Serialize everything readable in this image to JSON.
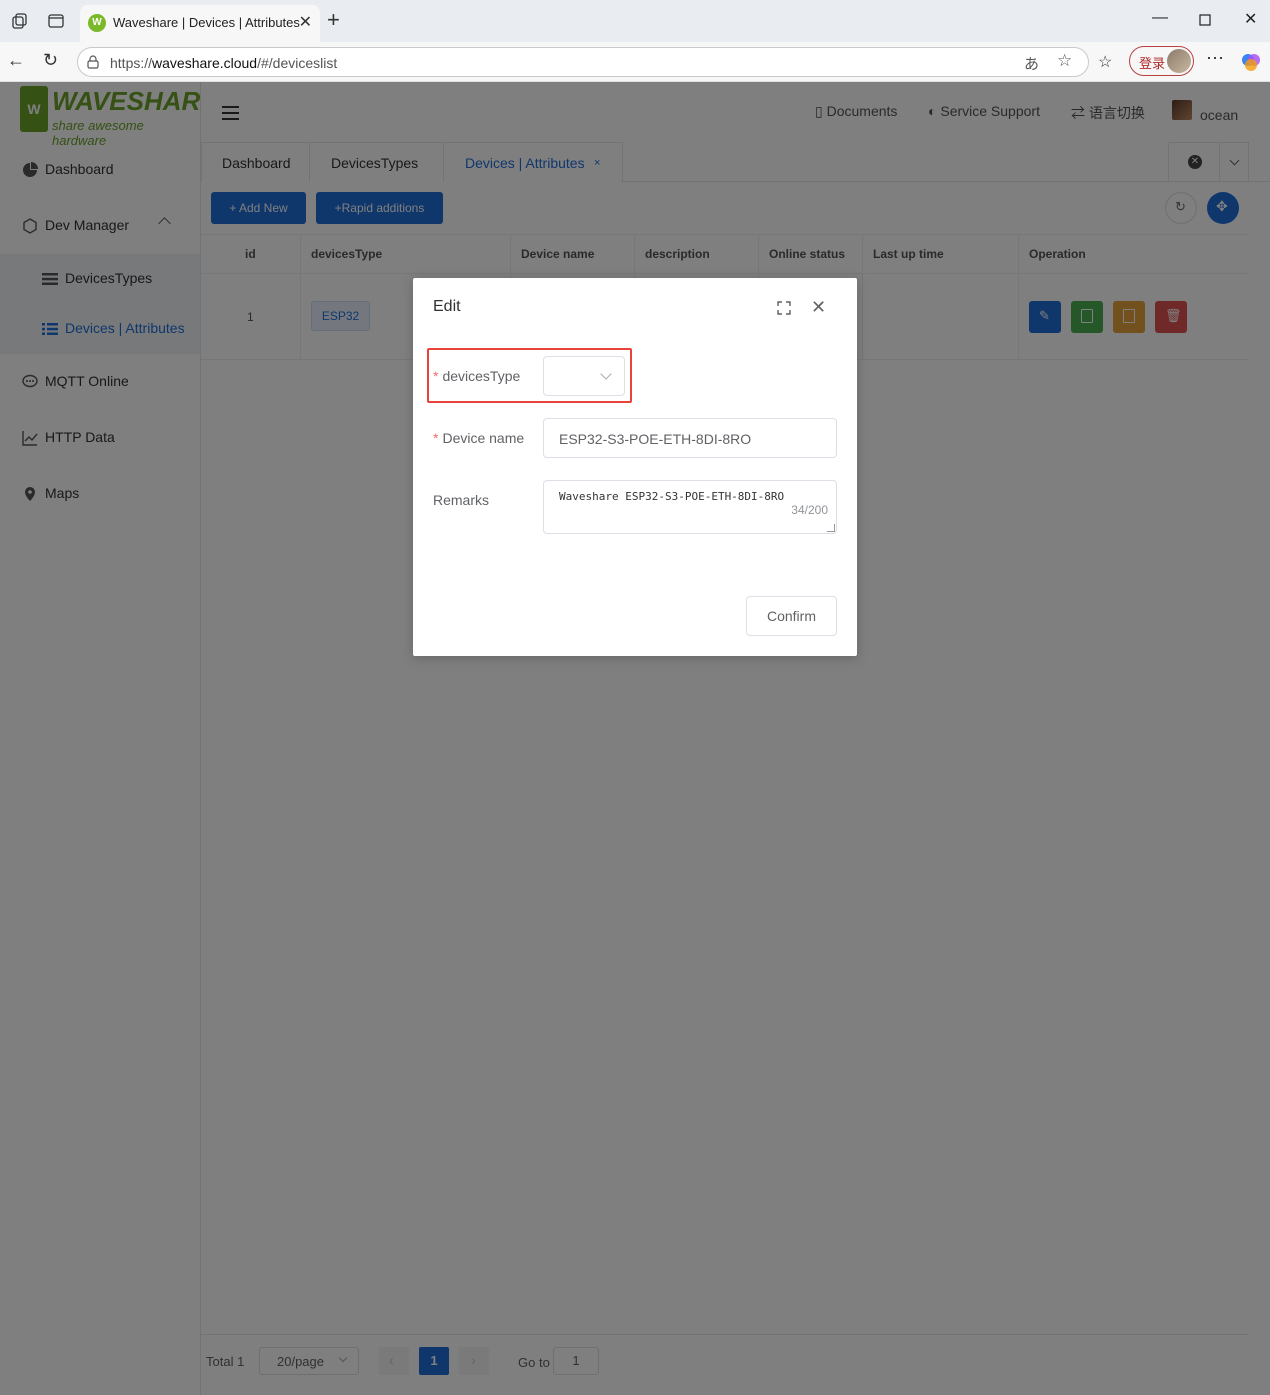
{
  "browser": {
    "tab_title": "Waveshare | Devices | Attributes",
    "url_prefix": "https://",
    "url_domain": "waveshare.cloud",
    "url_path": "/#/deviceslist",
    "login_label": "登录"
  },
  "sidebar": {
    "logo_text": "WAVESHARE",
    "logo_sub": "share awesome hardware",
    "items": [
      {
        "label": "Dashboard",
        "icon": "pie-chart-icon"
      },
      {
        "label": "Dev Manager",
        "icon": "hexagon-icon"
      },
      {
        "label": "DevicesTypes",
        "icon": "list-icon"
      },
      {
        "label": "Devices | Attributes",
        "icon": "list-icon"
      },
      {
        "label": "MQTT Online",
        "icon": "chat-icon"
      },
      {
        "label": "HTTP Data",
        "icon": "line-chart-icon"
      },
      {
        "label": "Maps",
        "icon": "map-pin-icon"
      }
    ]
  },
  "header": {
    "documents": "Documents",
    "service_support": "Service Support",
    "language": "语言切换",
    "username": "ocean"
  },
  "page_tabs": [
    {
      "label": "Dashboard"
    },
    {
      "label": "DevicesTypes"
    },
    {
      "label": "Devices | Attributes",
      "close": "×"
    }
  ],
  "toolbar": {
    "add_new": "+ Add New",
    "rapid_additions": "+Rapid additions"
  },
  "table": {
    "columns": [
      "id",
      "devicesType",
      "Device name",
      "description",
      "Online status",
      "Last up time",
      "Operation"
    ],
    "rows": [
      {
        "id": "1",
        "devicesType": "ESP32"
      }
    ]
  },
  "pagination": {
    "total": "Total 1",
    "page_size": "20/page",
    "current_page": "1",
    "goto_label": "Go to",
    "goto_value": "1"
  },
  "dialog": {
    "title": "Edit",
    "devicesType_label": "devicesType",
    "devicesType_value": "",
    "device_name_label": "Device name",
    "device_name_value": "ESP32-S3-POE-ETH-8DI-8RO",
    "remarks_label": "Remarks",
    "remarks_value": "Waveshare ESP32-S3-POE-ETH-8DI-8RO",
    "remarks_count": "34/200",
    "confirm_label": "Confirm"
  },
  "colors": {
    "primary": "#1e6fd9",
    "success": "#4caf50",
    "warning": "#e6a23c",
    "danger": "#e15353",
    "highlight_border": "#e8443a",
    "brand_green": "#6aa229"
  }
}
